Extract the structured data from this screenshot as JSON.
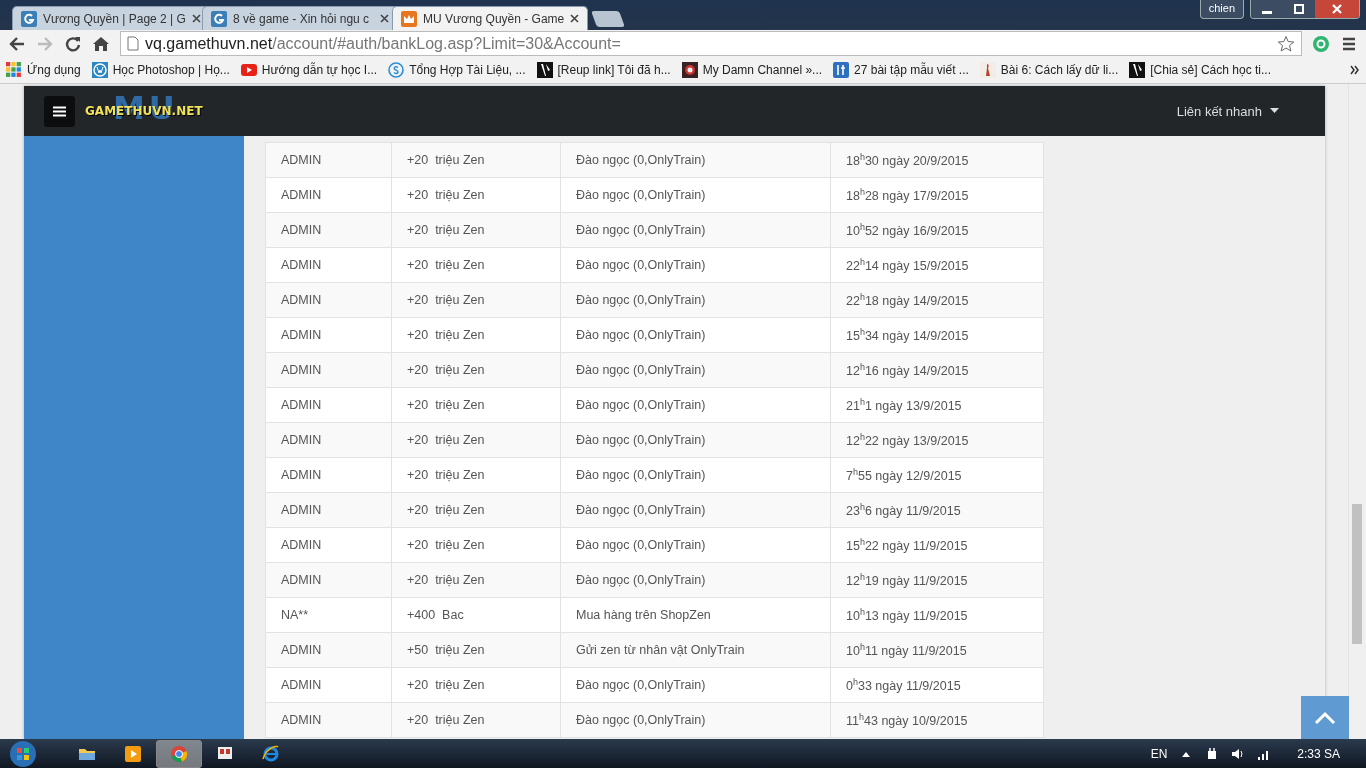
{
  "browser": {
    "tabs": [
      {
        "title": "Vương Quyền | Page 2 | G",
        "selected": false
      },
      {
        "title": "8 về game - Xin hỏi ngu c",
        "selected": false
      },
      {
        "title": "MU Vương Quyền - Game",
        "selected": true
      }
    ],
    "user": "chien",
    "url_host": "vq.gamethuvn.net",
    "url_path": "/account/#auth/bankLog.asp?Limit=30&Account=",
    "bookmarks": [
      {
        "label": "Ứng dụng"
      },
      {
        "label": "Học Photoshop | Họ..."
      },
      {
        "label": "Hướng dẫn tự học I..."
      },
      {
        "label": "Tổng Hợp Tài Liệu, ..."
      },
      {
        "label": "[Reup link] Tôi đã h..."
      },
      {
        "label": "My Damn Channel »..."
      },
      {
        "label": "27 bài tập mẫu viết ..."
      },
      {
        "label": "Bài 6: Cách lấy dữ li..."
      },
      {
        "label": "[Chia sẻ] Cách học ti..."
      }
    ]
  },
  "site": {
    "logo": "GAMETHUVN.NET",
    "logo_back": "MU",
    "quick_links": "Liên kết nhanh"
  },
  "table": {
    "rows": [
      {
        "user": "ADMIN",
        "amount": "+20  triệu Zen",
        "note": "Đào ngọc (0,OnlyTrain)",
        "time": "18$^{h}$30 ngày 20/9/2015"
      },
      {
        "user": "ADMIN",
        "amount": "+20  triệu Zen",
        "note": "Đào ngọc (0,OnlyTrain)",
        "time": "18$^{h}$28 ngày 17/9/2015"
      },
      {
        "user": "ADMIN",
        "amount": "+20  triệu Zen",
        "note": "Đào ngọc (0,OnlyTrain)",
        "time": "10$^{h}$52 ngày 16/9/2015"
      },
      {
        "user": "ADMIN",
        "amount": "+20  triệu Zen",
        "note": "Đào ngọc (0,OnlyTrain)",
        "time": "22$^{h}$14 ngày 15/9/2015"
      },
      {
        "user": "ADMIN",
        "amount": "+20  triệu Zen",
        "note": "Đào ngọc (0,OnlyTrain)",
        "time": "22$^{h}$18 ngày 14/9/2015"
      },
      {
        "user": "ADMIN",
        "amount": "+20  triệu Zen",
        "note": "Đào ngọc (0,OnlyTrain)",
        "time": "15$^{h}$34 ngày 14/9/2015"
      },
      {
        "user": "ADMIN",
        "amount": "+20  triệu Zen",
        "note": "Đào ngọc (0,OnlyTrain)",
        "time": "12$^{h}$16 ngày 14/9/2015"
      },
      {
        "user": "ADMIN",
        "amount": "+20  triệu Zen",
        "note": "Đào ngọc (0,OnlyTrain)",
        "time": "21$^{h}$1 ngày 13/9/2015"
      },
      {
        "user": "ADMIN",
        "amount": "+20  triệu Zen",
        "note": "Đào ngọc (0,OnlyTrain)",
        "time": "12$^{h}$22 ngày 13/9/2015"
      },
      {
        "user": "ADMIN",
        "amount": "+20  triệu Zen",
        "note": "Đào ngọc (0,OnlyTrain)",
        "time": "7$^{h}$55 ngày 12/9/2015"
      },
      {
        "user": "ADMIN",
        "amount": "+20  triệu Zen",
        "note": "Đào ngọc (0,OnlyTrain)",
        "time": "23$^{h}$6 ngày 11/9/2015"
      },
      {
        "user": "ADMIN",
        "amount": "+20  triệu Zen",
        "note": "Đào ngọc (0,OnlyTrain)",
        "time": "15$^{h}$22 ngày 11/9/2015"
      },
      {
        "user": "ADMIN",
        "amount": "+20  triệu Zen",
        "note": "Đào ngọc (0,OnlyTrain)",
        "time": "12$^{h}$19 ngày 11/9/2015"
      },
      {
        "user": "NA**",
        "amount": "+400  Bac",
        "note": "Mua hàng trên ShopZen",
        "time": "10$^{h}$13 ngày 11/9/2015"
      },
      {
        "user": "ADMIN",
        "amount": "+50  triệu Zen",
        "note": "Gửi zen từ nhân vật OnlyTrain",
        "time": "10$^{h}$11 ngày 11/9/2015"
      },
      {
        "user": "ADMIN",
        "amount": "+20  triệu Zen",
        "note": "Đào ngọc (0,OnlyTrain)",
        "time": "0$^{h}$33 ngày 11/9/2015"
      },
      {
        "user": "ADMIN",
        "amount": "+20  triệu Zen",
        "note": "Đào ngọc (0,OnlyTrain)",
        "time": "11$^{h}$43 ngày 10/9/2015"
      }
    ]
  },
  "taskbar": {
    "apps": [
      {
        "selected": false
      },
      {
        "selected": false
      },
      {
        "selected": true
      },
      {
        "selected": false
      },
      {
        "selected": false
      }
    ],
    "language": "EN",
    "clock": "2:33 SA"
  }
}
